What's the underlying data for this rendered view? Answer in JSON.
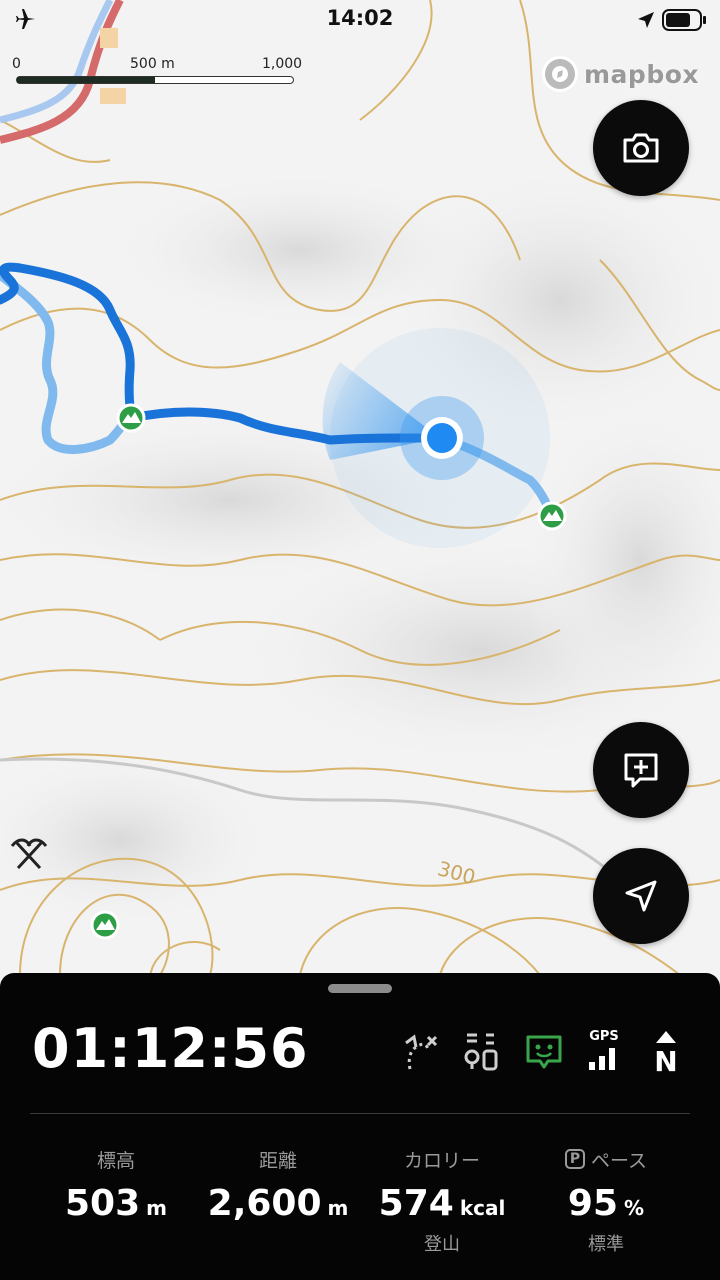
{
  "status": {
    "time": "14:02",
    "airplane_icon": "airplane-icon",
    "location_icon": "location-arrow-icon",
    "battery_icon": "battery-icon"
  },
  "scale": {
    "label_0": "0",
    "label_mid": "500 m",
    "label_max": "1,000 m",
    "fill_fraction": 0.5
  },
  "attribution": {
    "text": "mapbox"
  },
  "map": {
    "contour_label": "300",
    "track_color": "#1a73d9",
    "track_light_color": "#6fb2ec",
    "peak_color": "#2e9e46",
    "contour_color": "#d8b46c"
  },
  "buttons": {
    "camera_icon": "camera-icon",
    "add_memo_icon": "add-memo-icon",
    "navigate_icon": "navigate-arrow-icon"
  },
  "panel": {
    "elapsed": "01:12:56",
    "icons": [
      "route-off-icon",
      "waypoint-list-icon",
      "companion-icon",
      "gps-signal-icon",
      "north-up-icon"
    ],
    "gps_label": "GPS",
    "north_label": "N",
    "stats": [
      {
        "label": "標高",
        "value": "503",
        "unit": "m",
        "sub": ""
      },
      {
        "label": "距離",
        "value": "2,600",
        "unit": "m",
        "sub": ""
      },
      {
        "label": "カロリー",
        "value": "574",
        "unit": "kcal",
        "sub": "登山"
      },
      {
        "label": "ペース",
        "value": "95",
        "unit": "%",
        "sub": "標準",
        "badge": "P"
      }
    ]
  }
}
